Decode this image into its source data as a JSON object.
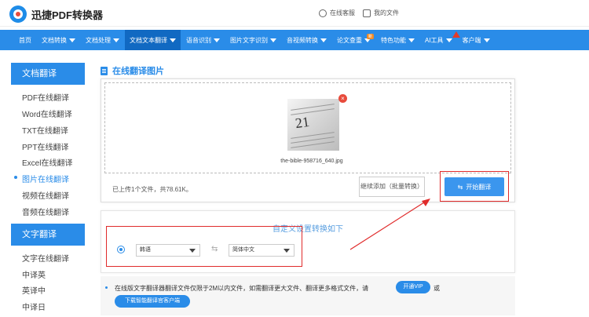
{
  "header": {
    "brand": "迅捷PDF转换器",
    "service_label": "在线客服",
    "files_label": "我的文件"
  },
  "nav": {
    "items": [
      {
        "label": "首页"
      },
      {
        "label": "文档转换"
      },
      {
        "label": "文档处理"
      },
      {
        "label": "文档文本翻译"
      },
      {
        "label": "语音识别"
      },
      {
        "label": "图片文字识别"
      },
      {
        "label": "音视频转换"
      },
      {
        "label": "论文查重",
        "badge": "新"
      },
      {
        "label": "特色功能"
      },
      {
        "label": "AI工具"
      },
      {
        "label": "客户端"
      }
    ]
  },
  "sidebar": {
    "section1": "文档翻译",
    "items1": [
      "PDF在线翻译",
      "Word在线翻译",
      "TXT在线翻译",
      "PPT在线翻译",
      "Excel在线翻译",
      "图片在线翻译",
      "视频在线翻译",
      "音频在线翻译"
    ],
    "active_index": 5,
    "section2": "文字翻译",
    "items2": [
      "文字在线翻译",
      "中译英",
      "英译中",
      "中译日"
    ]
  },
  "main": {
    "title": "在线翻译图片",
    "file_name": "the-bible-958716_640.jpg",
    "thumb_text": "21",
    "uploaded_text": "已上传1个文件，共78.61K。",
    "add_button": "继续添加（批量转换）",
    "start_button": "开始翻译",
    "settings_title": "自定义设置转换如下",
    "source_lang": "韩语",
    "target_lang": "简体中文",
    "notice": "在线版文字翻译器翻译文件仅限于2M以内文件，如需翻译更大文件、翻译更多格式文件，请",
    "vip_button": "开通VIP",
    "or_text": "或",
    "download_button": "下载智能翻译官客户端"
  },
  "colors": {
    "primary": "#2a8ce8",
    "highlight": "#e02b2b"
  }
}
